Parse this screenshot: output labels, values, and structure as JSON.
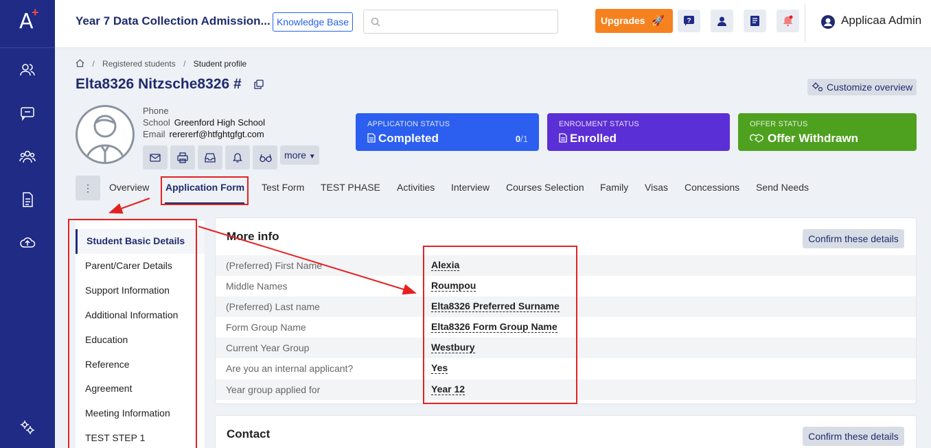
{
  "app": {
    "logo_letter": "A",
    "title": "Year 7 Data Collection Admission...",
    "knowledge_base": "Knowledge Base",
    "search_placeholder": "",
    "upgrades": "Upgrades",
    "user_name": "Applicaa Admin"
  },
  "breadcrumb": [
    "Registered students",
    "Student profile"
  ],
  "student": {
    "name": "Elta8326 Nitzsche8326 #",
    "customize": "Customize overview",
    "phone_label": "Phone",
    "school_label": "School",
    "school": "Greenford High School",
    "email_label": "Email",
    "email": "rerererf@htfghtgfgt.com",
    "more": "more"
  },
  "statuses": [
    {
      "label": "APPLICATION STATUS",
      "value": "Completed",
      "count": "0",
      "total": "/1",
      "color": "#2c5ff0"
    },
    {
      "label": "ENROLMENT STATUS",
      "value": "Enrolled",
      "color": "#5b2fd6"
    },
    {
      "label": "OFFER STATUS",
      "value": "Offer Withdrawn",
      "color": "#4ea11f"
    }
  ],
  "tabs": [
    "Overview",
    "Application Form",
    "Test Form",
    "TEST PHASE",
    "Activities",
    "Interview",
    "Courses Selection",
    "Family",
    "Visas",
    "Concessions",
    "Send Needs"
  ],
  "steps": [
    "Student Basic Details",
    "Parent/Carer Details",
    "Support Information",
    "Additional Information",
    "Education",
    "Reference",
    "Agreement",
    "Meeting Information",
    "TEST STEP 1"
  ],
  "more_info": {
    "title": "More info",
    "confirm": "Confirm these details",
    "rows": [
      {
        "k": "(Preferred) First Name",
        "v": "Alexia"
      },
      {
        "k": "Middle Names",
        "v": "Roumpou"
      },
      {
        "k": "(Preferred) Last name",
        "v": "Elta8326 Preferred Surname"
      },
      {
        "k": "Form Group Name",
        "v": "Elta8326 Form Group Name"
      },
      {
        "k": "Current Year Group",
        "v": "Westbury"
      },
      {
        "k": "Are you an internal applicant?",
        "v": "Yes"
      },
      {
        "k": "Year group applied for",
        "v": "Year 12"
      }
    ]
  },
  "contact": {
    "title": "Contact",
    "confirm": "Confirm these details"
  }
}
